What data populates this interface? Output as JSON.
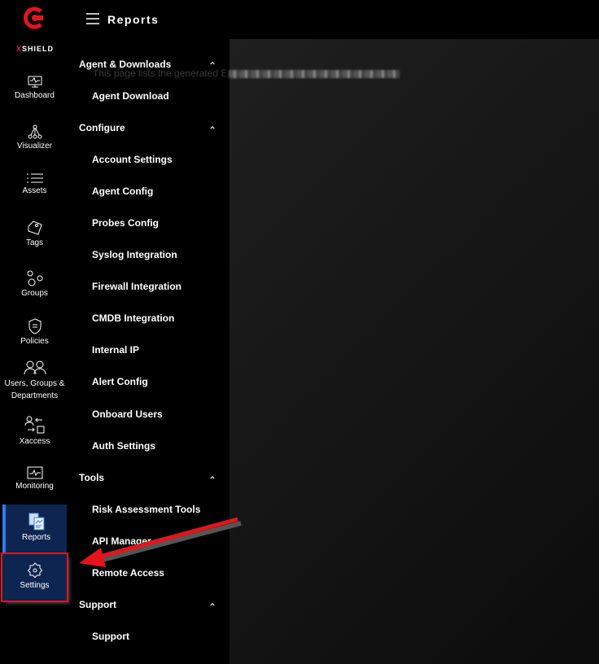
{
  "brand": {
    "prefix": "X",
    "name": "SHIELD",
    "accent": "#e0196f",
    "logo_color": "#e5141b"
  },
  "header": {
    "title": "Reports"
  },
  "main": {
    "description": "This page lists the generated E"
  },
  "rail": [
    {
      "label": "Dashboard",
      "icon": "monitor-icon"
    },
    {
      "label": "Visualizer",
      "icon": "network-icon"
    },
    {
      "label": "Assets",
      "icon": "list-icon"
    },
    {
      "label": "Tags",
      "icon": "tag-icon"
    },
    {
      "label": "Groups",
      "icon": "groups-icon"
    },
    {
      "label": "Policies",
      "icon": "shield-icon"
    },
    {
      "label": "Users, Groups &",
      "label2": "Departments",
      "icon": "users-icon"
    },
    {
      "label": "Xaccess",
      "icon": "xaccess-icon"
    },
    {
      "label": "Monitoring",
      "icon": "pulse-icon"
    },
    {
      "label": "Reports",
      "icon": "reports-icon",
      "active": true
    },
    {
      "label": "Settings",
      "icon": "gear-icon",
      "highlighted": true
    }
  ],
  "submenu": [
    {
      "heading": "Agent & Downloads",
      "items": [
        "Agent Download"
      ]
    },
    {
      "heading": "Configure",
      "items": [
        "Account Settings",
        "Agent Config",
        "Probes Config",
        "Syslog Integration",
        "Firewall Integration",
        "CMDB Integration",
        "Internal IP",
        "Alert Config",
        "Onboard Users",
        "Auth Settings"
      ]
    },
    {
      "heading": "Tools",
      "items": [
        "Risk Assessment Tools",
        "API Manager",
        "Remote Access"
      ]
    },
    {
      "heading": "Support",
      "items": [
        "Support"
      ]
    }
  ],
  "annotation": {
    "arrow_color": "#e5141b"
  }
}
